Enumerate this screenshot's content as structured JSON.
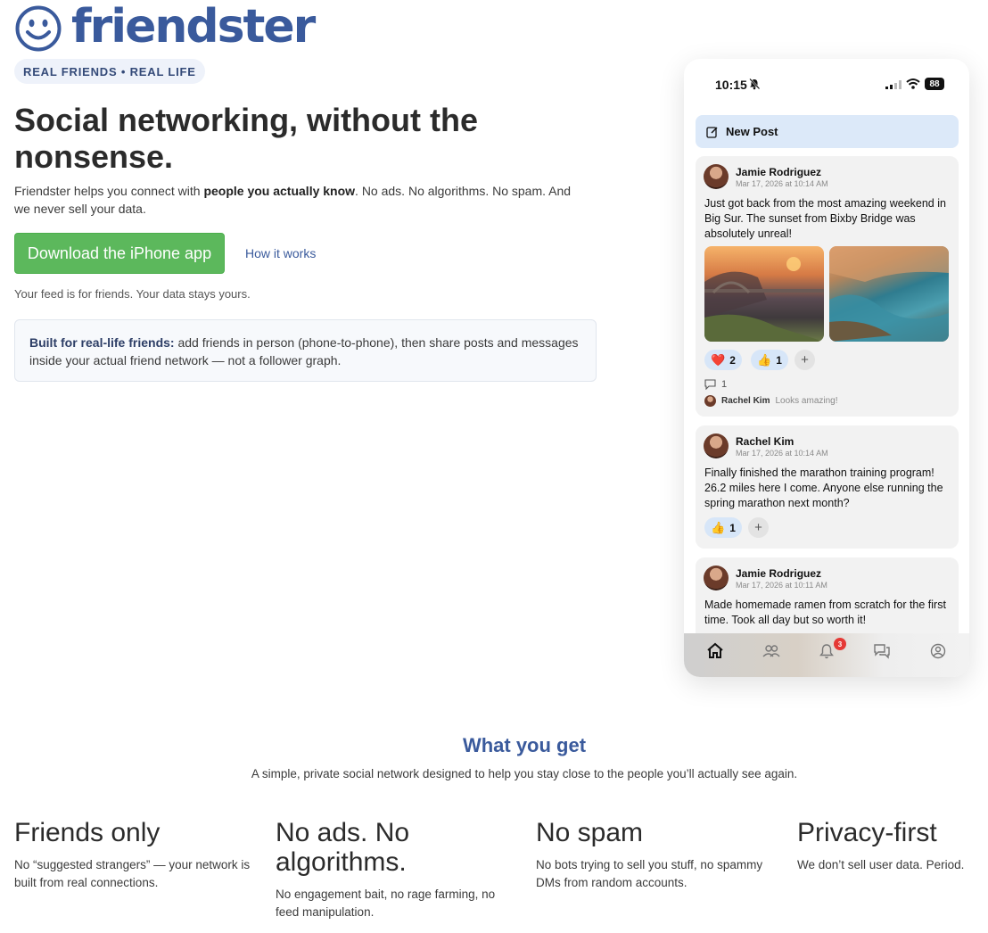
{
  "brand": {
    "name": "friendster",
    "tagline": "REAL FRIENDS • REAL LIFE",
    "color": "#3a5a9c"
  },
  "hero": {
    "headline": "Social networking, without the nonsense.",
    "sub_prefix": "Friendster helps you connect with ",
    "sub_bold": "people you actually know",
    "sub_suffix": ". No ads. No algorithms. No spam. And we never sell your data.",
    "download_label": "Download the iPhone app",
    "how_label": "How it works",
    "feed_note": "Your feed is for friends. Your data stays yours.",
    "info_bold": "Built for real-life friends:",
    "info_text": " add friends in person (phone-to-phone), then share posts and messages inside your actual friend network — not a follower graph."
  },
  "phone": {
    "time": "10:15",
    "battery": "88",
    "new_post_label": "New Post",
    "posts": [
      {
        "author": "Jamie Rodriguez",
        "date": "Mar 17, 2026 at 10:14 AM",
        "text": "Just got back from the most amazing weekend in Big Sur. The sunset from Bixby Bridge was absolutely unreal!",
        "reactions": [
          {
            "emoji": "❤️",
            "count": "2"
          },
          {
            "emoji": "👍",
            "count": "1"
          }
        ],
        "comment_count": "1",
        "comment_author": "Rachel Kim",
        "comment_text": "Looks amazing!"
      },
      {
        "author": "Rachel Kim",
        "date": "Mar 17, 2026 at 10:14 AM",
        "text": "Finally finished the marathon training program! 26.2 miles here I come. Anyone else running the spring marathon next month?",
        "reactions": [
          {
            "emoji": "👍",
            "count": "1"
          }
        ]
      },
      {
        "author": "Jamie Rodriguez",
        "date": "Mar 17, 2026 at 10:11 AM",
        "text": "Made homemade ramen from scratch for the first time. Took all day but so worth it!"
      }
    ],
    "notification_badge": "3",
    "tabs": [
      "home-icon",
      "friends-icon",
      "bell-icon",
      "messages-icon",
      "profile-icon"
    ]
  },
  "features_section": {
    "title": "What you get",
    "subtitle": "A simple, private social network designed to help you stay close to the people you’ll actually see again.",
    "items": [
      {
        "title": "Friends only",
        "text": "No “suggested strangers” — your network is built from real connections."
      },
      {
        "title": "No ads. No algorithms.",
        "text": "No engagement bait, no rage farming, no feed manipulation."
      },
      {
        "title": "No spam",
        "text": "No bots trying to sell you stuff, no spammy DMs from random accounts."
      },
      {
        "title": "Privacy-first",
        "text": "We don’t sell user data. Period."
      }
    ]
  }
}
